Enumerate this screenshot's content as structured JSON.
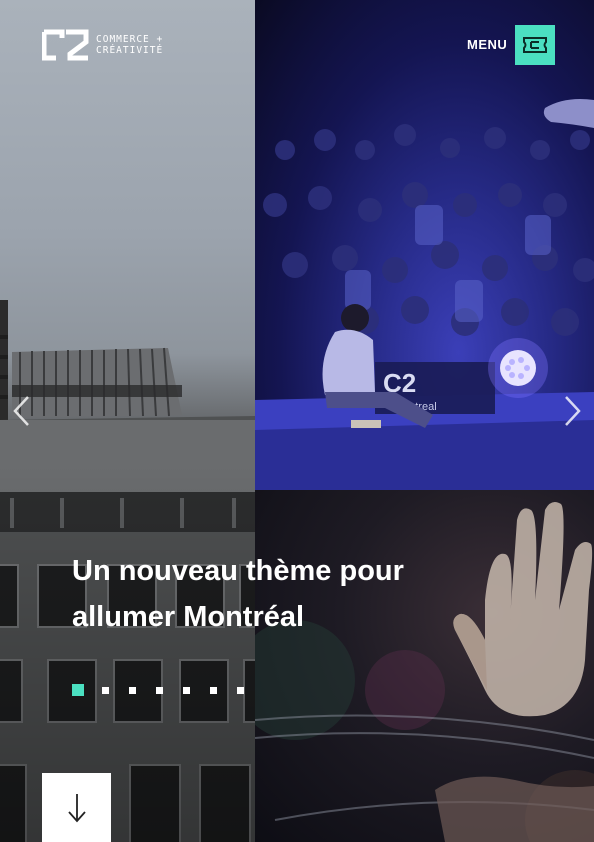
{
  "header": {
    "logo": {
      "mark": "C2",
      "line1": "COMMERCE +",
      "line2": "CRÉATIVITÉ"
    },
    "menu_label": "MENU",
    "menu_icon": "ticket-icon"
  },
  "hero": {
    "headline_line1": "Un nouveau thème pour",
    "headline_line2": "allumer Montréal",
    "slides_total": 7,
    "active_slide": 1,
    "stage_sign": "C2",
    "stage_sign_sub": "ontreal"
  },
  "controls": {
    "prev_icon": "chevron-left-icon",
    "next_icon": "chevron-right-icon",
    "scroll_icon": "arrow-down-icon"
  },
  "colors": {
    "accent": "#4be0c1",
    "text": "#ffffff",
    "stage_purple": "#2b2f9e"
  }
}
